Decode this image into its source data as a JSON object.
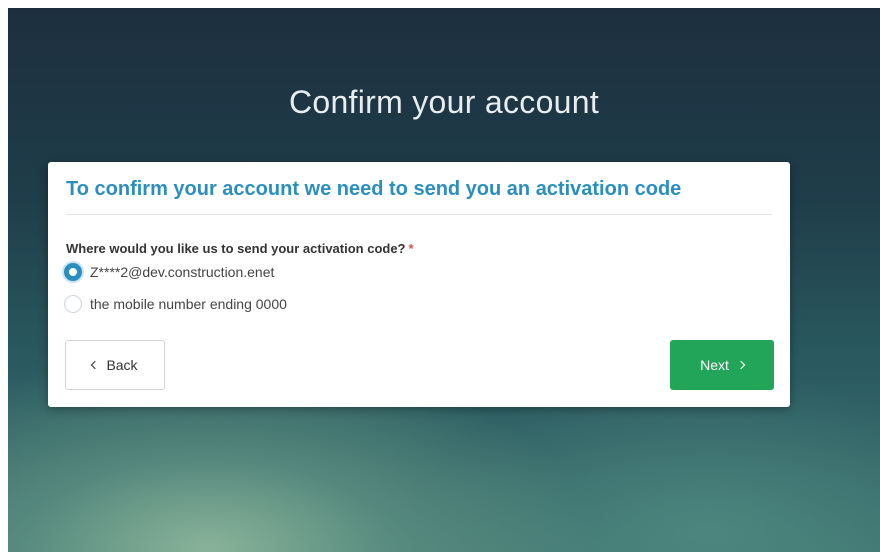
{
  "page": {
    "title": "Confirm your account"
  },
  "card": {
    "heading": "To confirm your account we need to send you an activation code",
    "question": "Where would you like us to send your activation code?",
    "required_marker": "*",
    "options": [
      {
        "label": "Z****2@dev.construction.enet",
        "selected": true
      },
      {
        "label": "the mobile number ending 0000",
        "selected": false
      }
    ],
    "back_label": "Back",
    "next_label": "Next"
  },
  "colors": {
    "heading": "#2a8fbf",
    "radio_selected": "#2a8fbf",
    "next_button": "#23a559",
    "required": "#d9534f"
  },
  "icons": {
    "back": "chevron-left-icon",
    "next": "chevron-right-icon"
  }
}
